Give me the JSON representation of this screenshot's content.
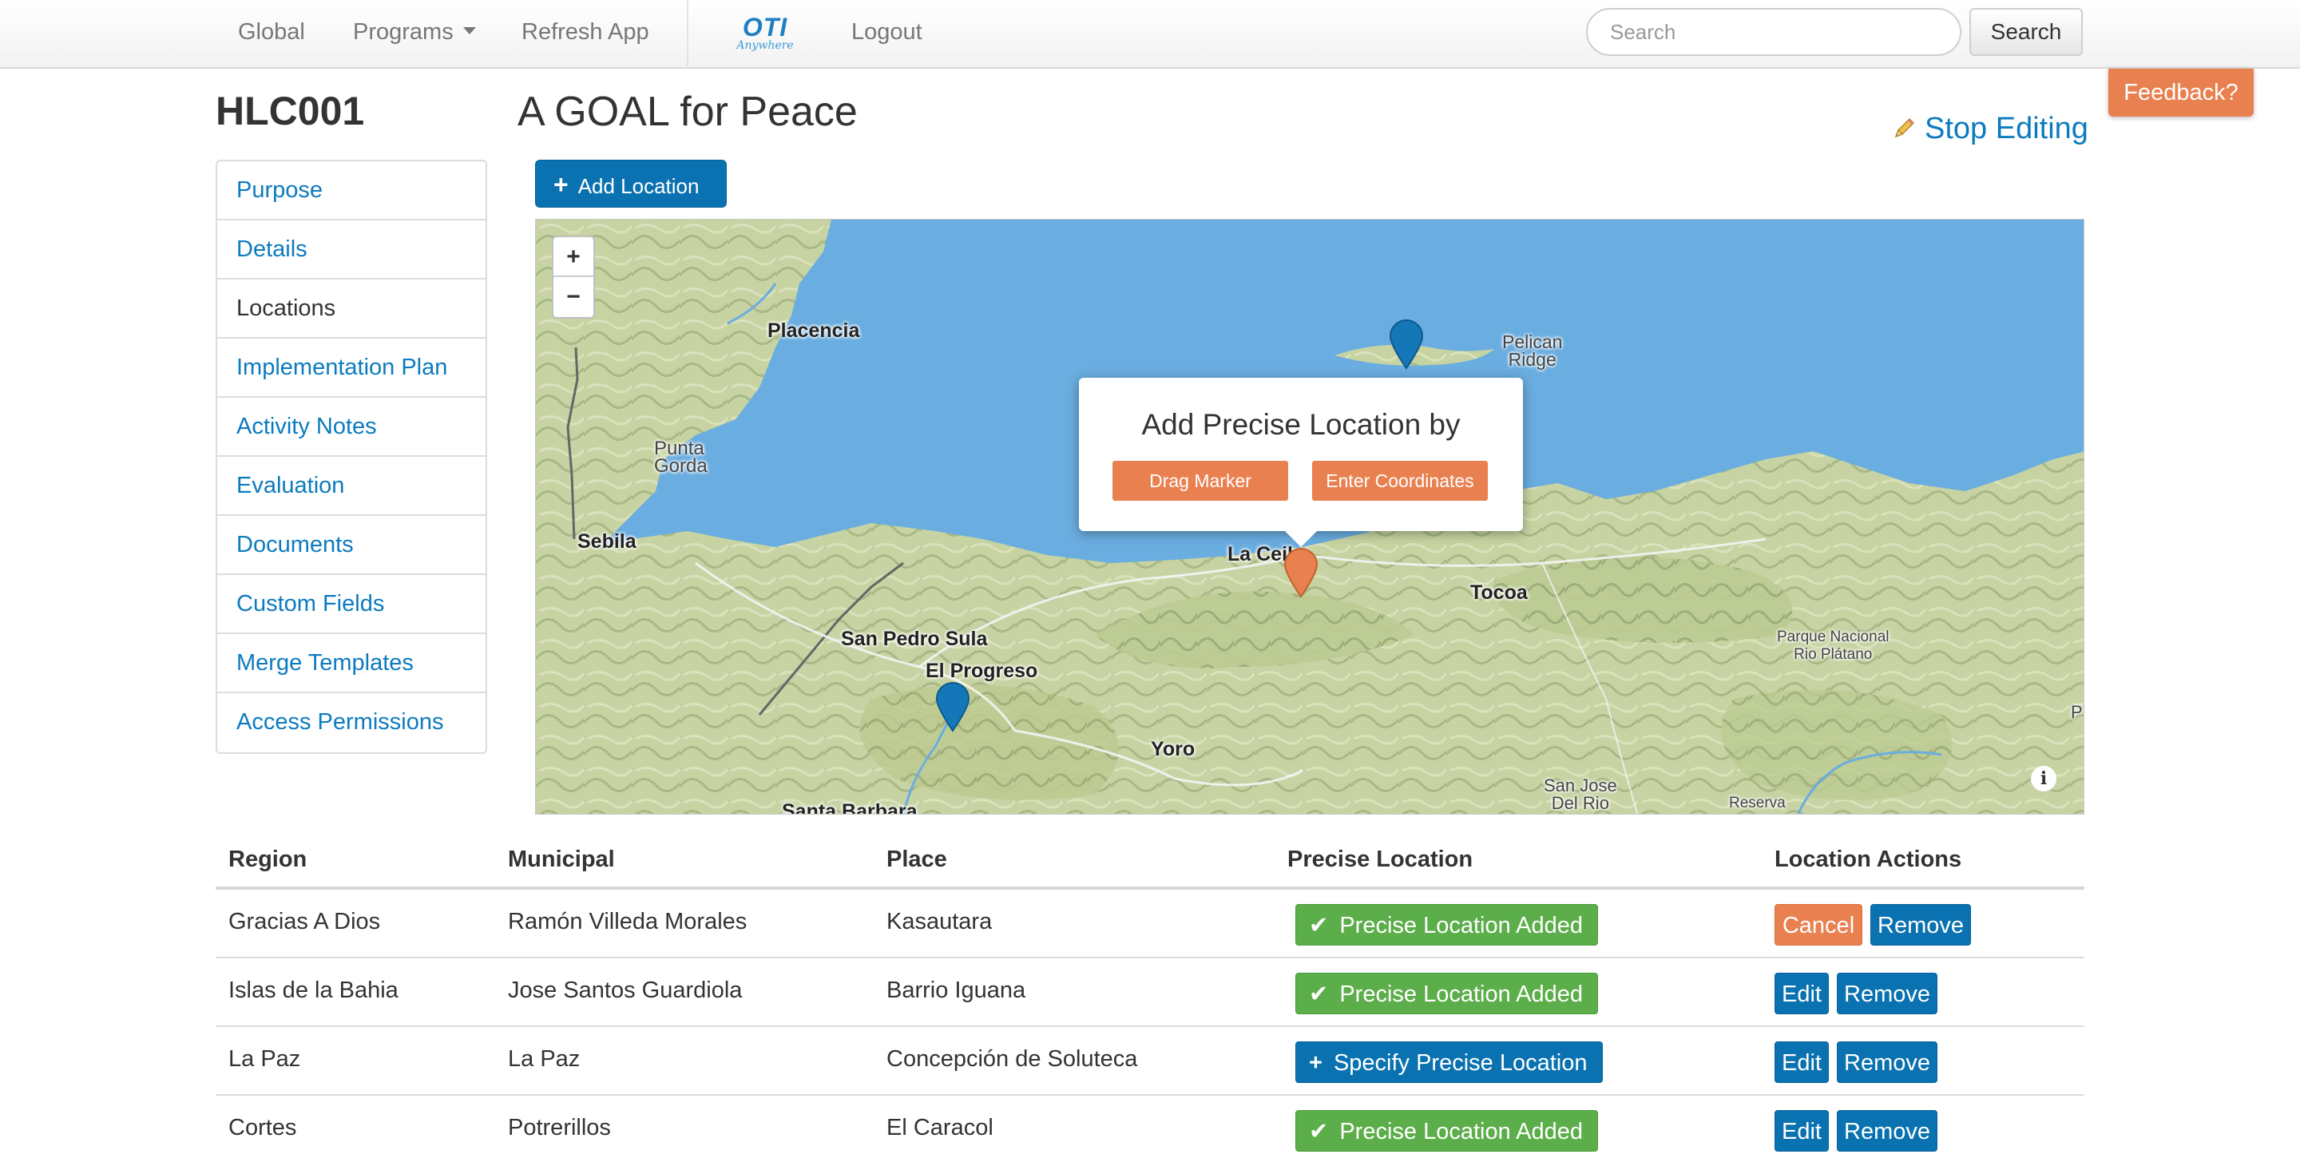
{
  "navbar": {
    "items": [
      {
        "label": "Global"
      },
      {
        "label": "Programs"
      },
      {
        "label": "Refresh App"
      },
      {
        "label": "Logout"
      }
    ],
    "logo_text": "OTI",
    "logo_subtext": "Anywhere",
    "search": {
      "placeholder": "Search",
      "value": "",
      "button_label": "Search"
    }
  },
  "feedback_label": "Feedback?",
  "project_code": "HLC001",
  "page_title": "A GOAL for Peace",
  "stop_editing_label": "Stop Editing",
  "sidebar": {
    "items": [
      {
        "label": "Purpose",
        "active": false
      },
      {
        "label": "Details",
        "active": false
      },
      {
        "label": "Locations",
        "active": true
      },
      {
        "label": "Implementation Plan",
        "active": false
      },
      {
        "label": "Activity Notes",
        "active": false
      },
      {
        "label": "Evaluation",
        "active": false
      },
      {
        "label": "Documents",
        "active": false
      },
      {
        "label": "Custom Fields",
        "active": false
      },
      {
        "label": "Merge Templates",
        "active": false
      },
      {
        "label": "Access Permissions",
        "active": false
      }
    ]
  },
  "add_location_label": "Add Location",
  "map": {
    "zoom_in": "+",
    "zoom_out": "−",
    "labels": {
      "placencia": "Placencia",
      "punta_gorda": "Punta\nGorda",
      "sebila": "Sebila",
      "pelican_ridge": "Pelican\nRidge",
      "la_ceiba": "La Ceiba",
      "tocoa": "Tocoa",
      "san_pedro_sula": "San Pedro Sula",
      "el_progreso": "El Progreso",
      "yoro": "Yoro",
      "santa_barbara": "Santa Barbara",
      "parque_nacional": "Parque Nacional\nRio Plátano",
      "san_jose": "San Jose\nDel Rio",
      "reserva": "Reserva",
      "edge_p": "P"
    },
    "info": "i",
    "popup": {
      "title": "Add Precise Location by",
      "drag_marker_label": "Drag Marker",
      "enter_coordinates_label": "Enter Coordinates"
    },
    "colors": {
      "water": "#6aade0",
      "land": "#c9d6a6",
      "marker_blue": "#1577b8",
      "marker_orange": "#e8804f"
    }
  },
  "table": {
    "headers": {
      "region": "Region",
      "municipal": "Municipal",
      "place": "Place",
      "precise": "Precise Location",
      "actions": "Location Actions"
    },
    "rows": [
      {
        "region": "Gracias A Dios",
        "municipal": "Ramón Villeda Morales",
        "place": "Kasautara",
        "precise_label": "Precise Location Added",
        "precise_state": "added",
        "action1": "Cancel",
        "action2": "Remove"
      },
      {
        "region": "Islas de la Bahia",
        "municipal": "Jose Santos Guardiola",
        "place": "Barrio Iguana",
        "precise_label": "Precise Location Added",
        "precise_state": "added",
        "action1": "Edit",
        "action2": "Remove"
      },
      {
        "region": "La Paz",
        "municipal": "La Paz",
        "place": "Concepción de Soluteca",
        "precise_label": "Specify Precise Location",
        "precise_state": "specify",
        "action1": "Edit",
        "action2": "Remove"
      },
      {
        "region": "Cortes",
        "municipal": "Potrerillos",
        "place": "El Caracol",
        "precise_label": "Precise Location Added",
        "precise_state": "added",
        "action1": "Edit",
        "action2": "Remove"
      }
    ]
  }
}
